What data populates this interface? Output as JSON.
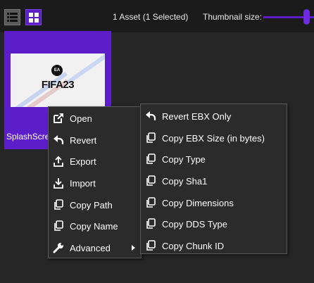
{
  "toolbar": {
    "asset_count": "1 Asset (1 Selected)",
    "thumbnail_size_label": "Thumbnail size:",
    "accent": "#5b1ec8",
    "thumbnail_size_level": 1.0
  },
  "asset": {
    "name": "SplashScreen",
    "brand_mark": "EA",
    "title": "FIFA23"
  },
  "context_menu": {
    "items": [
      {
        "label": "Open",
        "icon": "open-external-icon"
      },
      {
        "label": "Revert",
        "icon": "undo-arrow-icon"
      },
      {
        "label": "Export",
        "icon": "export-upload-icon"
      },
      {
        "label": "Import",
        "icon": "import-download-icon"
      },
      {
        "label": "Copy Path",
        "icon": "copy-icon"
      },
      {
        "label": "Copy Name",
        "icon": "copy-icon"
      },
      {
        "label": "Advanced",
        "icon": "wrench-icon"
      }
    ]
  },
  "advanced_menu": {
    "items": [
      {
        "label": "Revert EBX Only",
        "icon": "undo-arrow-icon"
      },
      {
        "label": "Copy EBX Size (in bytes)",
        "icon": "copy-icon"
      },
      {
        "label": "Copy Type",
        "icon": "copy-icon"
      },
      {
        "label": "Copy Sha1",
        "icon": "copy-icon"
      },
      {
        "label": "Copy Dimensions",
        "icon": "copy-icon"
      },
      {
        "label": "Copy DDS Type",
        "icon": "copy-icon"
      },
      {
        "label": "Copy Chunk ID",
        "icon": "copy-icon"
      }
    ]
  }
}
